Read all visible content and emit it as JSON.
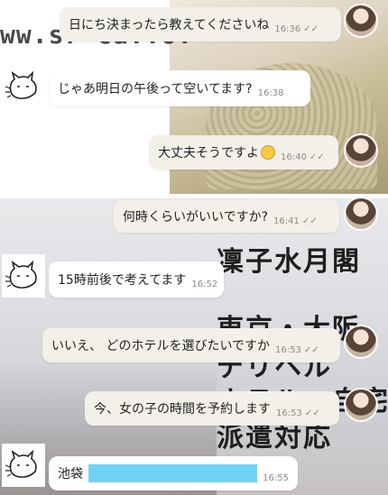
{
  "watermark": "ww.s7 ca..o.",
  "poster": {
    "line1": "凜子水月閣",
    "line2": "東京・大阪",
    "line3": "デリヘル",
    "line4": "ホテル・自宅",
    "line5": "派遣対応"
  },
  "messages": [
    {
      "text": "日にち決まったら教えてくださいね",
      "time": "16:36"
    },
    {
      "text": "じゃあ明日の午後って空いてます?",
      "time": "16:38"
    },
    {
      "text": "大丈夫そうですよ",
      "time": "16:40"
    },
    {
      "text": "何時くらいがいいですか?",
      "time": "16:41"
    },
    {
      "text": "15時前後で考えてます",
      "time": "16:52"
    },
    {
      "text": "いいえ、 どのホテルを選びたいですか",
      "time": "16:53"
    },
    {
      "text": "今、女の子の時間を予約します",
      "time": "16:53"
    },
    {
      "text": "池袋",
      "time": "16:55"
    }
  ],
  "read_mark": "✓✓",
  "emoji": "smile-emoji",
  "colors": {
    "outgoing_bubble": "#f3f0e9",
    "incoming_bubble": "#ffffff",
    "redaction": "#6fd3f5"
  }
}
